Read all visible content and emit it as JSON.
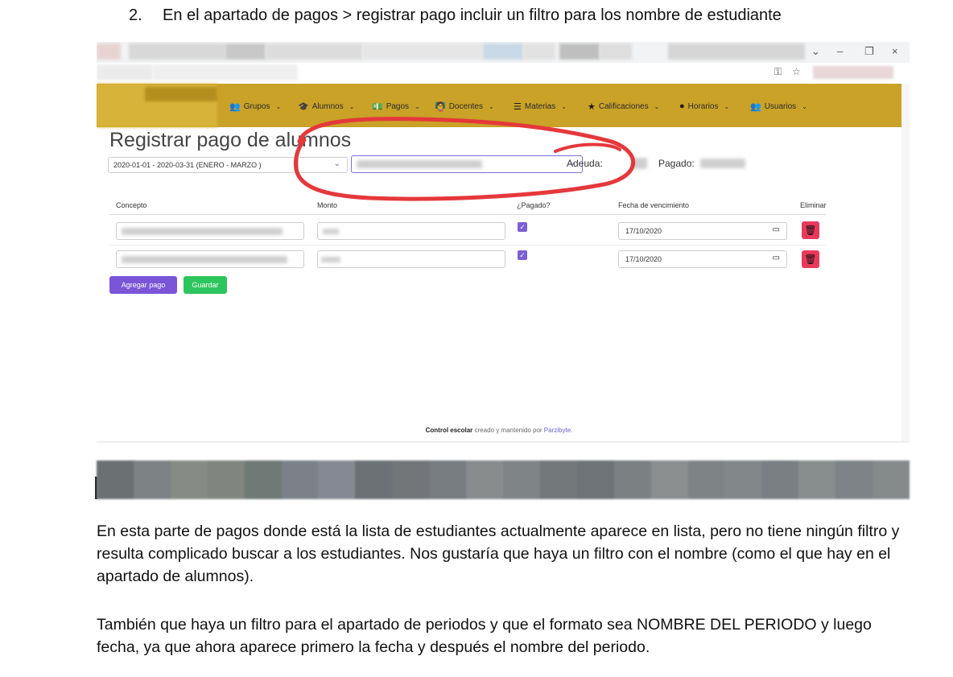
{
  "document": {
    "heading_number": "2.",
    "heading_text": "En el apartado de pagos > registrar pago incluir un filtro para los nombre de estudiante",
    "paragraph1": "En esta parte de pagos donde está la lista de estudiantes actualmente aparece en lista, pero no tiene ningún filtro y resulta complicado buscar a los estudiantes. Nos gustaría que haya un filtro con el nombre (como el que hay en el apartado de alumnos).",
    "paragraph2": "También que haya un filtro para el apartado de periodos y que el formato sea NOMBRE DEL PERIODO  y luego fecha, ya que ahora aparece primero la fecha y después el nombre del periodo."
  },
  "window": {
    "minimize": "–",
    "restore": "❐",
    "close": "×",
    "chevron": "⌄",
    "key_icon": "⚿",
    "star_icon": "☆"
  },
  "nav": {
    "items": [
      {
        "label": "Grupos",
        "icon": "users-icon",
        "glyph": "👥"
      },
      {
        "label": "Alumnos",
        "icon": "graduation-cap-icon",
        "glyph": "🎓"
      },
      {
        "label": "Pagos",
        "icon": "money-icon",
        "glyph": "💵"
      },
      {
        "label": "Docentes",
        "icon": "teacher-icon",
        "glyph": "🧑‍🏫"
      },
      {
        "label": "Materias",
        "icon": "list-icon",
        "glyph": "☰"
      },
      {
        "label": "Calificaciones",
        "icon": "star-icon",
        "glyph": "★"
      },
      {
        "label": "Horarios",
        "icon": "clock-icon",
        "glyph": "●"
      },
      {
        "label": "Usuarios",
        "icon": "users-icon",
        "glyph": "👥"
      }
    ],
    "chevron": "⌄",
    "color": "#c9a227"
  },
  "page": {
    "title": "Registrar pago de alumnos",
    "period_select_value": "2020-01-01 - 2020-03-31 (ENERO - MARZO )",
    "adeuda_label": "Adeuda:",
    "pagado_label": "Pagado:"
  },
  "table": {
    "headers": [
      "Concepto",
      "Monto",
      "¿Pagado?",
      "Fecha de vencimiento",
      "Eliminar"
    ],
    "rows": [
      {
        "date": "17/10/2020",
        "paid": true
      },
      {
        "date": "17/10/2020",
        "paid": true
      }
    ],
    "checkmark": "✓",
    "calendar_glyph": "▭",
    "trash_glyph": "🗑"
  },
  "buttons": {
    "add_payment": "Agregar pago",
    "save": "Guardar"
  },
  "footer": {
    "app_name": "Control escolar",
    "middle": " creado y mantenido por ",
    "company": "Parzibyte",
    "end": "."
  },
  "colors": {
    "accent_purple": "#7a55d8",
    "success_green": "#2dc55d",
    "danger_red": "#e8395a",
    "annotation_red": "#e5383b"
  }
}
